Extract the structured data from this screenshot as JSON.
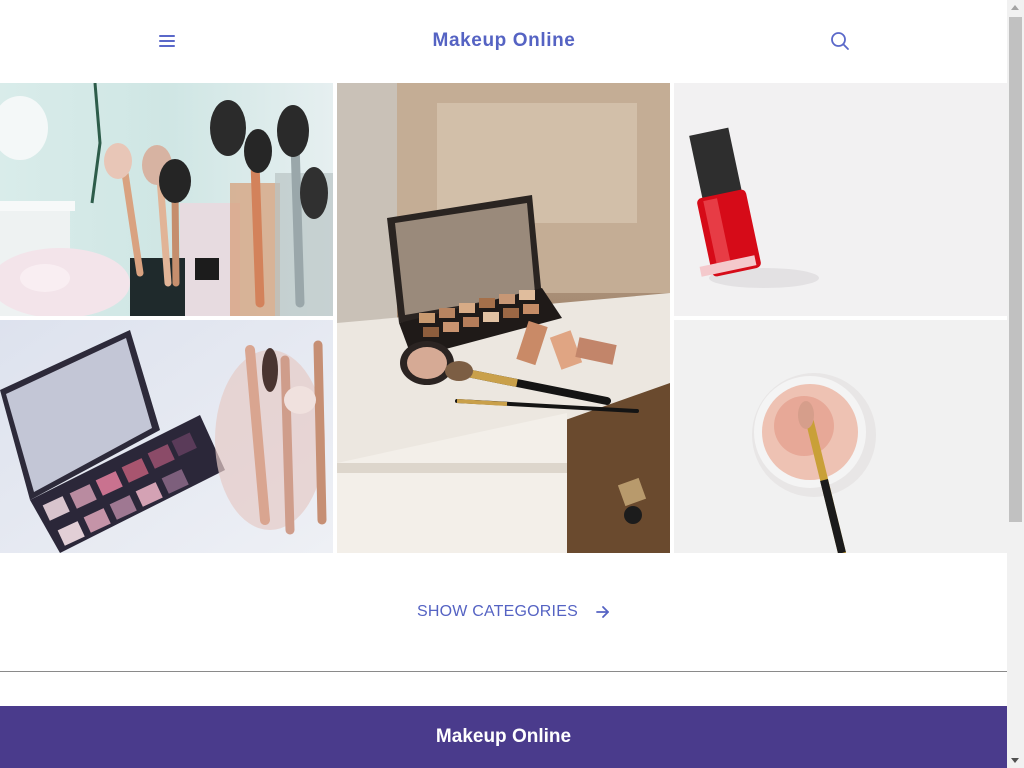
{
  "header": {
    "brand": "Makeup Online",
    "menu_icon": "hamburger-menu-icon",
    "search_icon": "search-icon"
  },
  "gallery": {
    "tiles": [
      {
        "subject": "makeup brushes in jars"
      },
      {
        "subject": "eyeshadow palette and brushes on white dresser"
      },
      {
        "subject": "red nail polish bottle"
      },
      {
        "subject": "pink eyeshadow palette with brushes"
      },
      {
        "subject": "loose powder jar with brush"
      }
    ]
  },
  "actions": {
    "show_categories_label": "SHOW CATEGORIES",
    "arrow_icon": "arrow-right-icon"
  },
  "footer": {
    "title": "Makeup Online"
  },
  "colors": {
    "accent": "#5563c3",
    "footer_bg": "#4a3b8c"
  }
}
